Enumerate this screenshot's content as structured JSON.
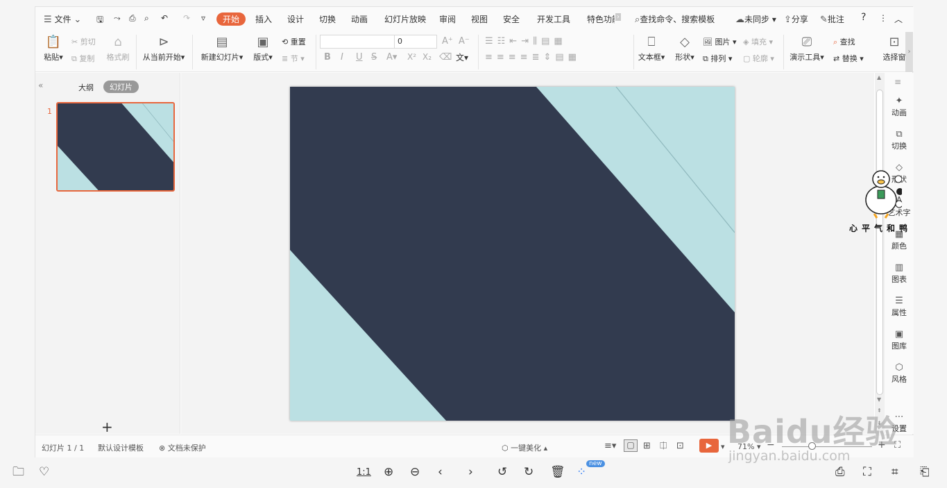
{
  "menubar": {
    "file": "文件",
    "tabs": [
      "开始",
      "插入",
      "设计",
      "切换",
      "动画",
      "幻灯片放映",
      "审阅",
      "视图",
      "安全",
      "开发工具",
      "特色功能"
    ],
    "search": "查找命令、搜索模板",
    "sync": "未同步",
    "share": "分享",
    "comment": "批注"
  },
  "ribbon": {
    "paste": "粘贴",
    "cut": "剪切",
    "copy": "复制",
    "format_painter": "格式刷",
    "from_current": "从当前开始",
    "new_slide": "新建幻灯片",
    "layout": "版式",
    "reset": "重置",
    "section": "节",
    "font_size": "0",
    "textbox": "文本框",
    "shape": "形状",
    "picture": "图片",
    "fill": "填充",
    "arrange": "排列",
    "outline": "轮廓",
    "presenter_tools": "演示工具",
    "find": "查找",
    "replace": "替换",
    "select_pane": "选择窗"
  },
  "leftpanel": {
    "outline_tab": "大纲",
    "slides_tab": "幻灯片",
    "slide_number": "1",
    "add": "+"
  },
  "rightbar": {
    "items": [
      "动画",
      "切换",
      "形状",
      "艺术字",
      "颜色",
      "图表",
      "属性",
      "图库",
      "风格",
      "设置"
    ]
  },
  "status": {
    "slide_info": "幻灯片 1 / 1",
    "template": "默认设计模板",
    "protect": "文档未保护",
    "beautify": "一键美化",
    "zoom": "71%"
  },
  "viewer": {
    "ratio": "1:1",
    "new_badge": "new"
  },
  "overlay": {
    "watermark": "Baidu经验",
    "watermark_url": "jingyan.baidu.com",
    "sticker_text": "心平气和鸭"
  },
  "colors": {
    "accent": "#e8663c",
    "slide_dark": "#323b4f",
    "slide_light": "#bbe0e3"
  }
}
